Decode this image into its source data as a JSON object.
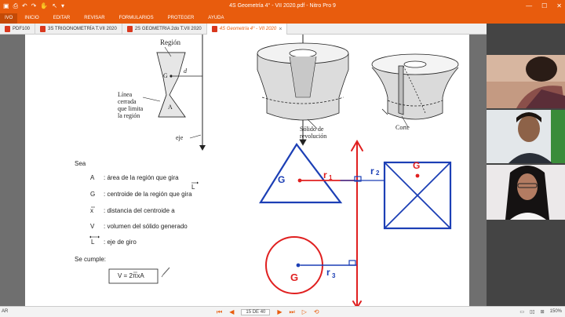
{
  "window": {
    "title": "4S Geometría 4° - VII 2020.pdf - Nitro Pro 9",
    "min": "—",
    "max": "☐",
    "close": "✕"
  },
  "menu": [
    "IVO",
    "INICIO",
    "EDITAR",
    "REVISAR",
    "FORMULARIOS",
    "PROTEGER",
    "AYUDA"
  ],
  "tabs": [
    {
      "label": "PDF100"
    },
    {
      "label": "3S TRIGONOMETRÍA T.VII 2020"
    },
    {
      "label": "2S GEOMETRIA 2do T.VII 2020"
    },
    {
      "label": "4S Geometría 4° - VII 2020"
    }
  ],
  "doc": {
    "region_label": "Región",
    "g_label": "G",
    "d_label": "d",
    "a_label": "A",
    "closed_line_1": "Línea",
    "closed_line_2": "cerrada",
    "closed_line_3": "que limita",
    "closed_line_4": "la región",
    "axis_label": "eje",
    "solid_label_1": "Sólido de",
    "solid_label_2": "revolución",
    "cut_label": "Corte",
    "sea": "Sea",
    "defs": [
      {
        "sym": "A",
        "text": ": área de la región que gira"
      },
      {
        "sym": "G",
        "text": ": centroide de la región que gira"
      },
      {
        "sym": "x",
        "text": ": distancia del centroide a"
      },
      {
        "sym": "V",
        "text": ": volumen del sólido generado"
      },
      {
        "sym": "L",
        "text": ": eje de giro"
      }
    ],
    "l_sym": "L",
    "se_cumple": "Se cumple:",
    "formula": "V = 2πxA"
  },
  "annot": {
    "g1": "G",
    "r1": "r",
    "r1sub": "1",
    "r2": "r",
    "r2sub": "2",
    "g2": "G",
    "g3": "G",
    "r3": "r",
    "r3sub": "3"
  },
  "status": {
    "left": "AR",
    "page": "15 DE 40",
    "zoom": "150%"
  },
  "colors": {
    "brand": "#e85c0d",
    "annotation_red": "#e02020",
    "annotation_blue": "#1c3fb5"
  }
}
